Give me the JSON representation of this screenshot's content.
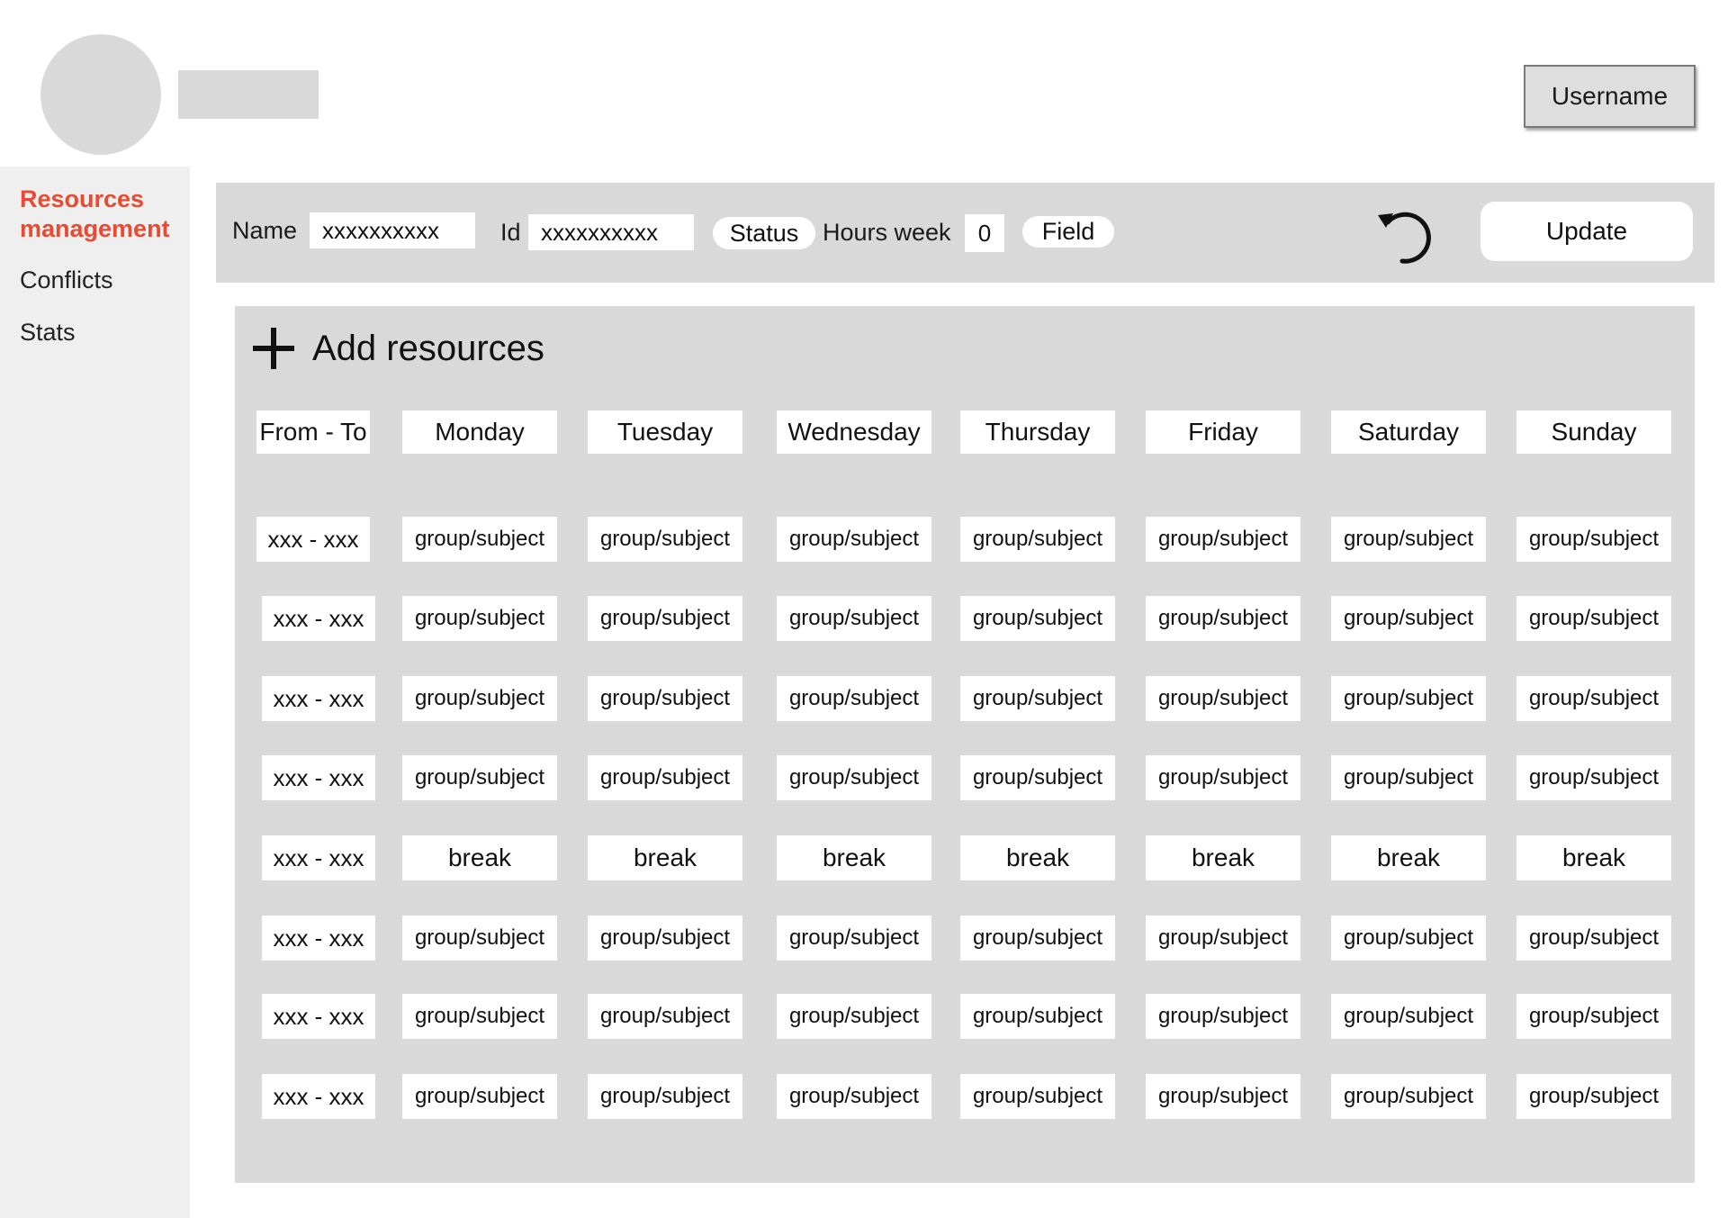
{
  "header": {
    "username": "Username"
  },
  "sidebar": {
    "items": [
      {
        "label": "Resources management",
        "active": true
      },
      {
        "label": "Conflicts",
        "active": false
      },
      {
        "label": "Stats",
        "active": false
      }
    ]
  },
  "filters": {
    "name_label": "Name",
    "name_value": "xxxxxxxxxx",
    "id_label": "Id",
    "id_value": "xxxxxxxxxx",
    "status_label": "Status",
    "hours_label": "Hours week",
    "hours_value": "0",
    "field_label": "Field",
    "refresh_icon": "refresh-icon",
    "update_label": "Update"
  },
  "schedule": {
    "add_label": "Add resources",
    "add_icon": "plus-icon",
    "columns": [
      "From - To",
      "Monday",
      "Tuesday",
      "Wednesday",
      "Thursday",
      "Friday",
      "Saturday",
      "Sunday"
    ],
    "rows": [
      {
        "time": "xxx - xxx",
        "cells": [
          "group/subject",
          "group/subject",
          "group/subject",
          "group/subject",
          "group/subject",
          "group/subject",
          "group/subject"
        ]
      },
      {
        "time": "xxx - xxx",
        "cells": [
          "group/subject",
          "group/subject",
          "group/subject",
          "group/subject",
          "group/subject",
          "group/subject",
          "group/subject"
        ]
      },
      {
        "time": "xxx - xxx",
        "cells": [
          "group/subject",
          "group/subject",
          "group/subject",
          "group/subject",
          "group/subject",
          "group/subject",
          "group/subject"
        ]
      },
      {
        "time": "xxx - xxx",
        "cells": [
          "group/subject",
          "group/subject",
          "group/subject",
          "group/subject",
          "group/subject",
          "group/subject",
          "group/subject"
        ]
      },
      {
        "time": "xxx - xxx",
        "cells": [
          "break",
          "break",
          "break",
          "break",
          "break",
          "break",
          "break"
        ]
      },
      {
        "time": "xxx - xxx",
        "cells": [
          "group/subject",
          "group/subject",
          "group/subject",
          "group/subject",
          "group/subject",
          "group/subject",
          "group/subject"
        ]
      },
      {
        "time": "xxx - xxx",
        "cells": [
          "group/subject",
          "group/subject",
          "group/subject",
          "group/subject",
          "group/subject",
          "group/subject",
          "group/subject"
        ]
      },
      {
        "time": "xxx - xxx",
        "cells": [
          "group/subject",
          "group/subject",
          "group/subject",
          "group/subject",
          "group/subject",
          "group/subject",
          "group/subject"
        ]
      }
    ]
  },
  "colors": {
    "accent": "#e84a32",
    "panel": "#d9d9d9",
    "sidebar": "#efefef"
  }
}
